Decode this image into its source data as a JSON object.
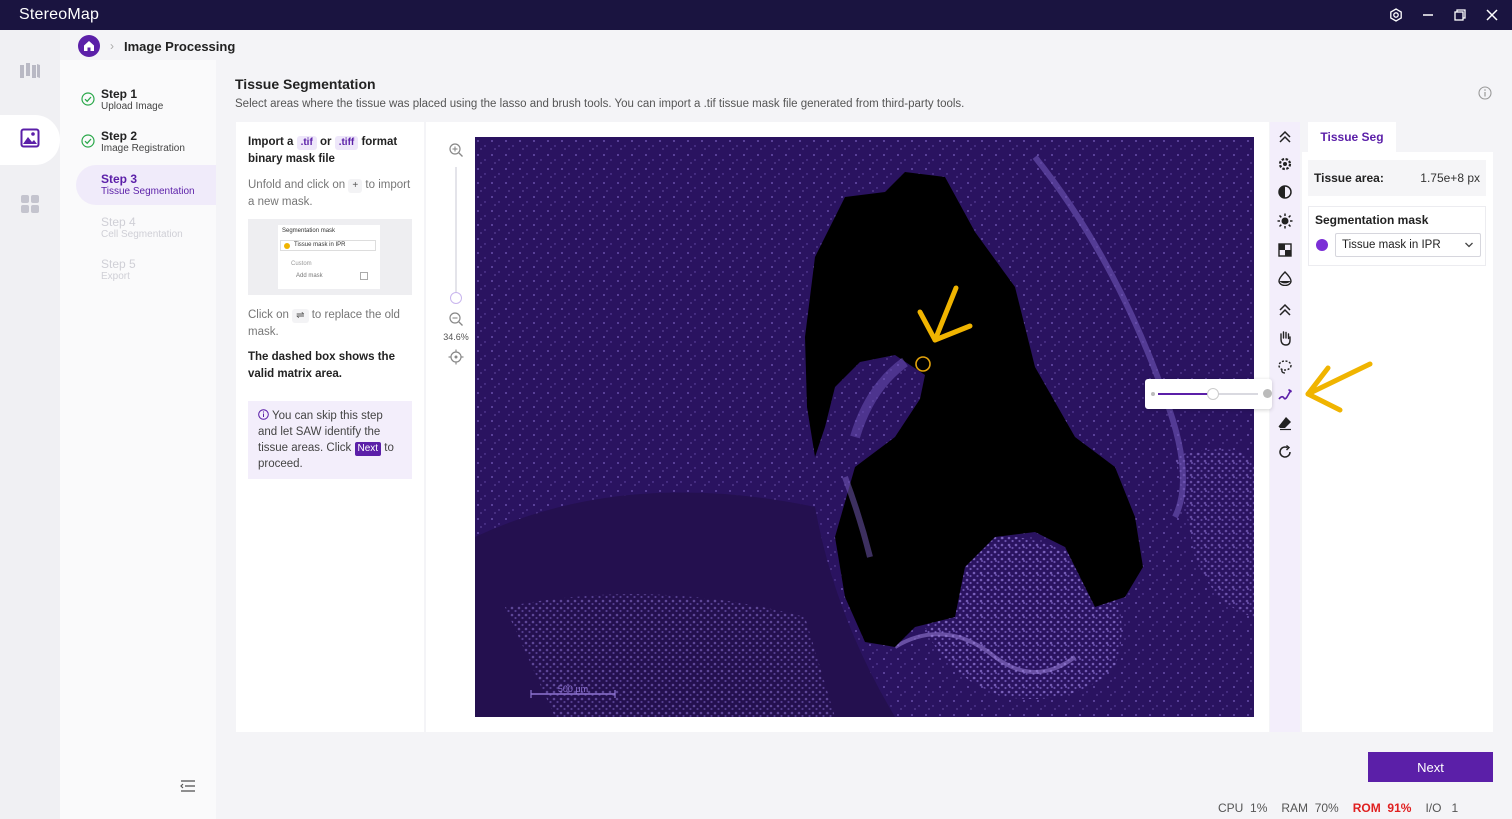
{
  "app": {
    "title": "StereoMap"
  },
  "breadcrumb": {
    "current": "Image Processing"
  },
  "steps": [
    {
      "title": "Step 1",
      "subtitle": "Upload Image",
      "state": "done"
    },
    {
      "title": "Step 2",
      "subtitle": "Image Registration",
      "state": "done"
    },
    {
      "title": "Step 3",
      "subtitle": "Tissue Segmentation",
      "state": "active"
    },
    {
      "title": "Step 4",
      "subtitle": "Cell Segmentation",
      "state": "disabled"
    },
    {
      "title": "Step 5",
      "subtitle": "Export",
      "state": "disabled"
    }
  ],
  "page": {
    "title": "Tissue Segmentation",
    "description": "Select areas where the tissue was placed using the lasso and brush tools. You can import a .tif tissue mask file generated from third-party tools."
  },
  "help": {
    "import_prefix": "Import a",
    "tif": ".tif",
    "or": "or",
    "tiff": ".tiff",
    "import_suffix": "format binary mask file",
    "unfold_prefix": "Unfold and click on",
    "plus": "+",
    "unfold_suffix": "to import a new mask.",
    "preview_title": "Segmentation mask",
    "preview_item": "Tissue mask in IPR",
    "preview_custom": "Custom",
    "preview_add": "Add mask",
    "replace_prefix": "Click on",
    "replace_icon": "⇌",
    "replace_suffix": "to replace the old mask.",
    "dashed_note": "The dashed box shows the valid matrix area.",
    "tip_prefix": "You can skip this step and let SAW identify the tissue areas. Click",
    "tip_next": "Next",
    "tip_suffix": "to proceed."
  },
  "zoom": {
    "level_label": "34.6%",
    "level_fraction": 0.0
  },
  "image": {
    "scale_bar": "500 μm"
  },
  "tools": [
    "collapse-up-icon",
    "settings-icon",
    "contrast-icon",
    "brightness-icon",
    "checker-icon",
    "saturation-icon",
    "collapse-up-icon",
    "hand-icon",
    "lasso-icon",
    "brush-icon",
    "eraser-icon",
    "redo-icon"
  ],
  "brush": {
    "size_fraction": 0.55
  },
  "panel": {
    "tab": "Tissue Seg",
    "area_label": "Tissue area:",
    "area_value": "1.75e+8 px",
    "mask_label": "Segmentation mask",
    "mask_selected": "Tissue mask in IPR"
  },
  "actions": {
    "next": "Next"
  },
  "status": {
    "cpu_label": "CPU",
    "cpu_value": "1%",
    "ram_label": "RAM",
    "ram_value": "70%",
    "rom_label": "ROM",
    "rom_value": "91%",
    "io_label": "I/O",
    "io_value": "1"
  },
  "colors": {
    "accent": "#5b1fa8",
    "titlebar": "#1a1440",
    "annotation": "#f0b400",
    "warning": "#e02020"
  }
}
